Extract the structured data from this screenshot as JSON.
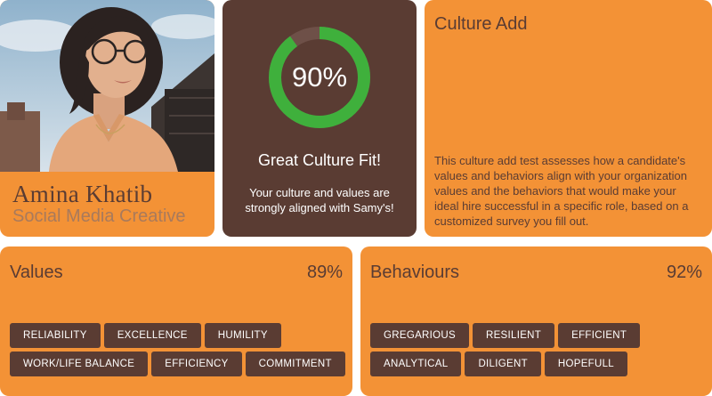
{
  "profile": {
    "name": "Amina Khatib",
    "role": "Social Media Creative"
  },
  "fit": {
    "percent_text": "90%",
    "percent_value": 90,
    "title": "Great Culture Fit!",
    "description": "Your culture and values are strongly aligned with Samy's!",
    "colors": {
      "ring": "#3fb03c",
      "track": "#6e5048"
    }
  },
  "culture_add": {
    "title": "Culture Add",
    "description": "This culture add test assesses how a candidate's values and behaviors align with your organization values and the behaviors that would make your ideal hire successful in a specific role, based on a customized survey you fill out."
  },
  "values": {
    "title": "Values",
    "percent": "89%",
    "tags": [
      "RELIABILITY",
      "EXCELLENCE",
      "HUMILITY",
      "WORK/LIFE BALANCE",
      "EFFICIENCY",
      "COMMITMENT"
    ]
  },
  "behaviours": {
    "title": "Behaviours",
    "percent": "92%",
    "tags": [
      "GREGARIOUS",
      "RESILIENT",
      "EFFICIENT",
      "ANALYTICAL",
      "DILIGENT",
      "HOPEFULL"
    ]
  },
  "colors": {
    "orange": "#f39236",
    "brown": "#5a3c33"
  }
}
